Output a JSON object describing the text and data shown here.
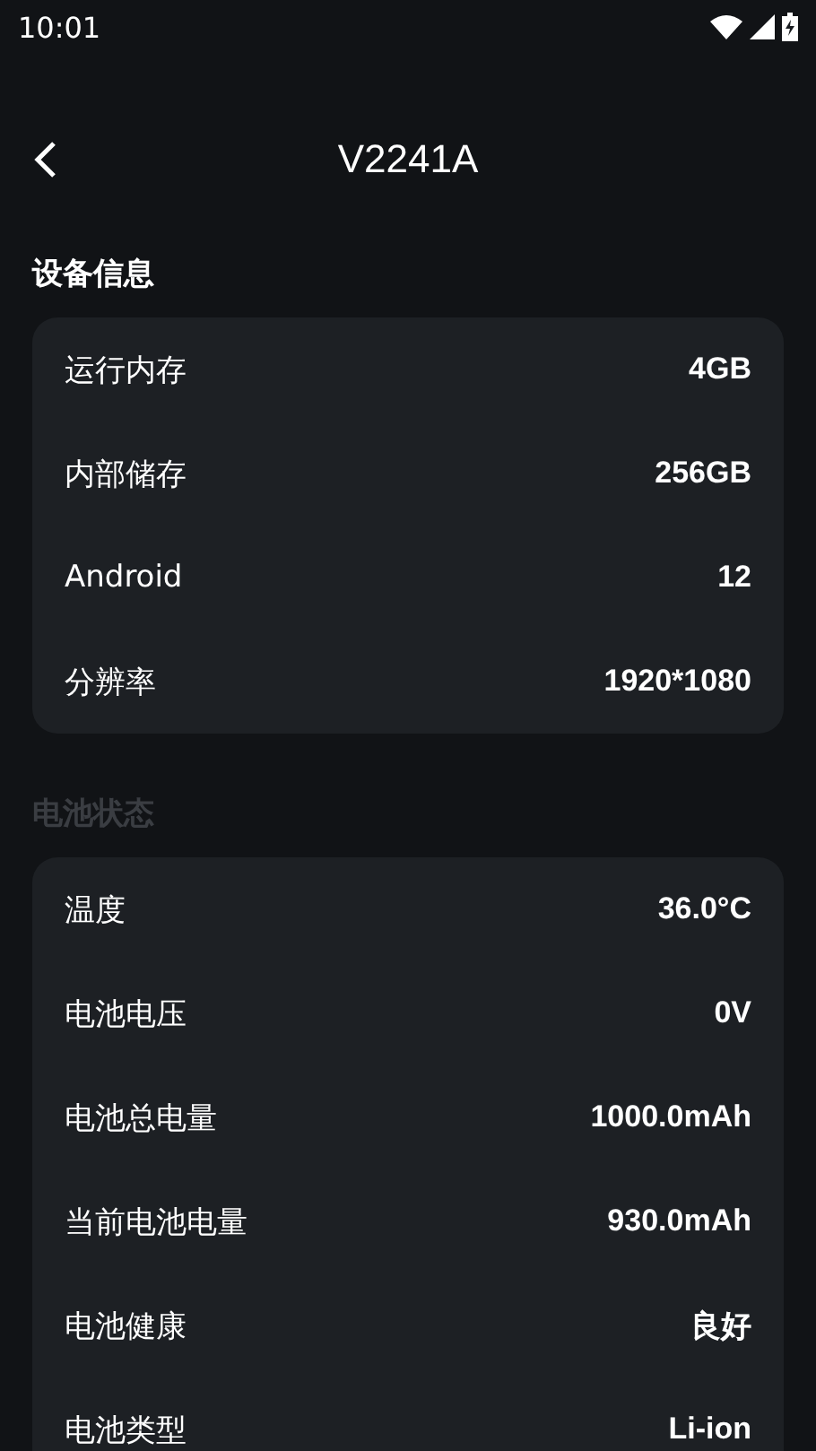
{
  "status_bar": {
    "time": "10:01"
  },
  "header": {
    "title": "V2241A"
  },
  "sections": [
    {
      "title": "设备信息",
      "rows": [
        {
          "label": "运行内存",
          "value": "4GB"
        },
        {
          "label": "内部储存",
          "value": "256GB"
        },
        {
          "label": "Android",
          "value": "12"
        },
        {
          "label": "分辨率",
          "value": "1920*1080"
        }
      ]
    },
    {
      "title": "电池状态",
      "rows": [
        {
          "label": "温度",
          "value": "36.0°C"
        },
        {
          "label": "电池电压",
          "value": "0V"
        },
        {
          "label": "电池总电量",
          "value": "1000.0mAh"
        },
        {
          "label": "当前电池电量",
          "value": "930.0mAh"
        },
        {
          "label": "电池健康",
          "value": "良好"
        },
        {
          "label": "电池类型",
          "value": "Li-ion"
        }
      ]
    }
  ]
}
